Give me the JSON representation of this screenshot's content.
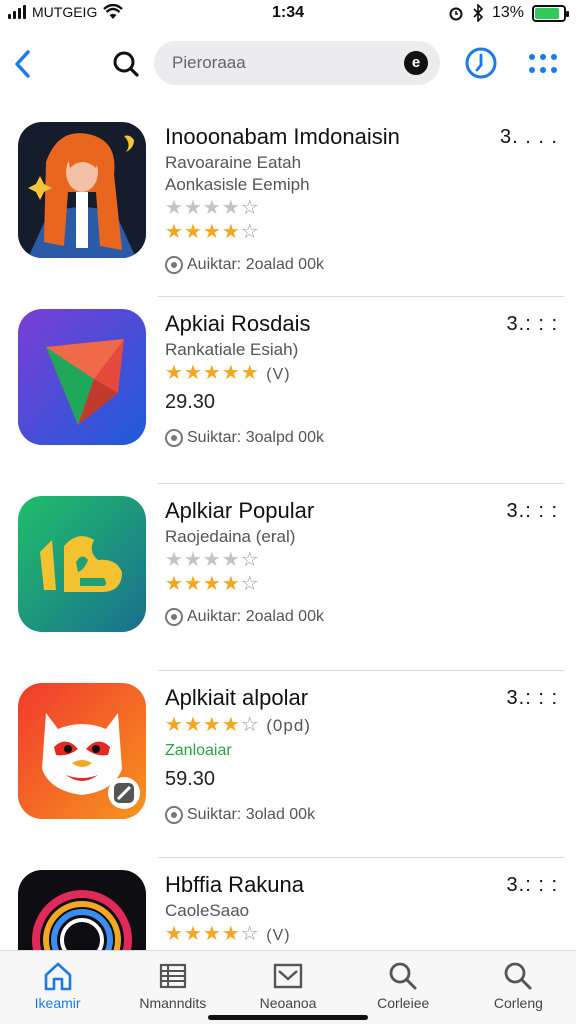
{
  "status_bar": {
    "carrier": "MUTGEIG",
    "time": "1:34",
    "battery": "13%",
    "battery_fill": 0.85
  },
  "search": {
    "placeholder": "Pieroraaa"
  },
  "apps": [
    {
      "title": "Inooonabam Imdonaisin",
      "subtitle_1": "Ravoaraine Eatah",
      "subtitle_2": "Aonkasisle Eemiph",
      "rating_gray": 4,
      "rating": 4,
      "rating_suffix": "",
      "price": "",
      "green_label": "",
      "meta": "Auiktar: 2oalad 00k",
      "more": "3. . . ."
    },
    {
      "title": "Apkiai Rosdais",
      "subtitle_1": "Rankatiale Esiah)",
      "subtitle_2": "",
      "rating_gray": 0,
      "rating": 4.5,
      "rating_suffix": "(V)",
      "price": "29.30",
      "green_label": "",
      "meta": "Suiktar: 3oalpd 00k",
      "more": "3.: : :"
    },
    {
      "title": "Aplkiar Popular",
      "subtitle_1": "Raojedaina (eral)",
      "subtitle_2": "",
      "rating_gray": 4,
      "rating": 4,
      "rating_suffix": "",
      "price": "",
      "green_label": "",
      "meta": "Auiktar: 2oalad 00k",
      "more": "3.: : :"
    },
    {
      "title": "Aplkiait alpolar",
      "subtitle_1": "",
      "subtitle_2": "",
      "rating_gray": 0,
      "rating": 4,
      "rating_suffix": "(0pd)",
      "price": "59.30",
      "green_label": "Zanloaiar",
      "meta": "Suiktar: 3olad 00k",
      "more": "3.: : :"
    },
    {
      "title": "Hbffia Rakuna",
      "subtitle_1": "CaoleSaao",
      "subtitle_2": "",
      "rating_gray": 0,
      "rating": 4,
      "rating_suffix": "(V)",
      "price": "",
      "green_label": "",
      "meta": "",
      "more": "3.: : :"
    }
  ],
  "tabs": [
    {
      "label": "Ikeamir",
      "icon": "home-icon"
    },
    {
      "label": "Nmanndits",
      "icon": "list-icon"
    },
    {
      "label": "Neoanoa",
      "icon": "inbox-icon"
    },
    {
      "label": "Corleiee",
      "icon": "search-icon"
    },
    {
      "label": "Corleng",
      "icon": "search-icon"
    }
  ],
  "colors": {
    "accent": "#1a7ae8",
    "star": "#f5a623",
    "green": "#2ea043"
  }
}
